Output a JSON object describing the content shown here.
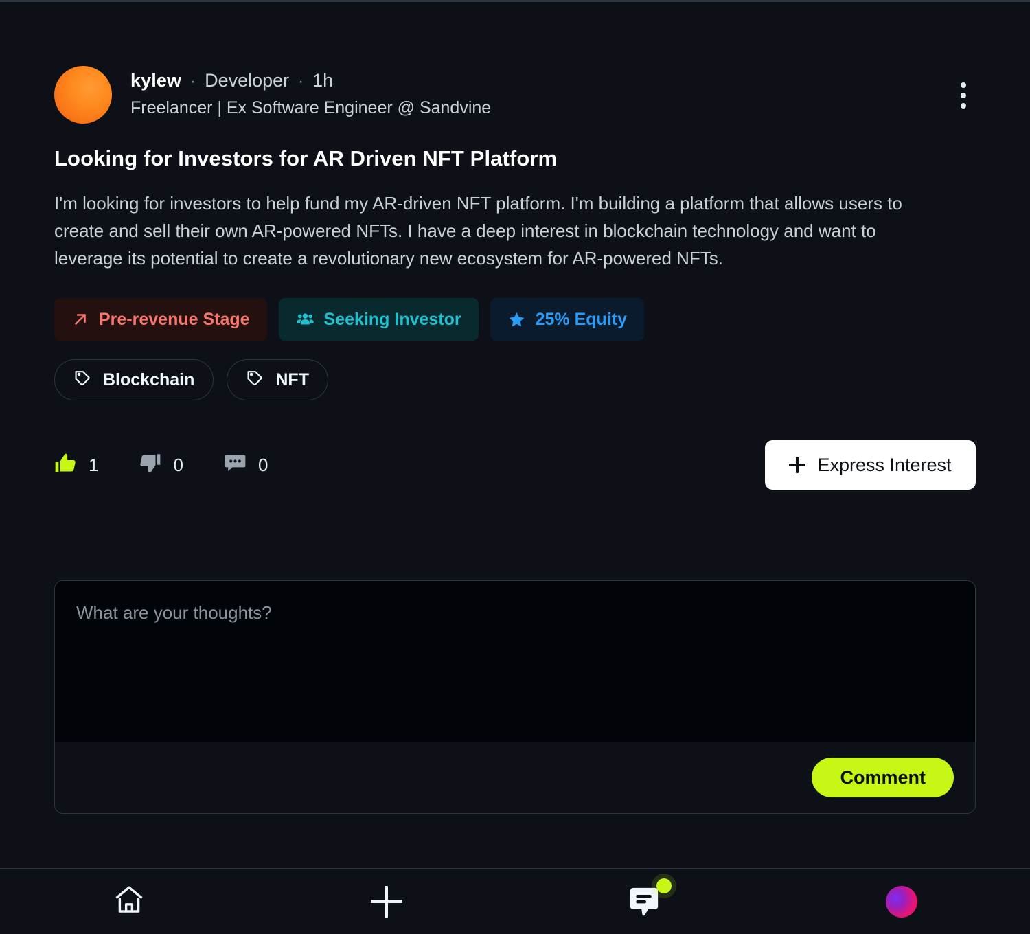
{
  "post": {
    "author": {
      "username": "kylew",
      "role": "Developer",
      "timestamp": "1h",
      "headline": "Freelancer | Ex Software Engineer @ Sandvine",
      "avatar_icon": "user-avatar",
      "avatar_color": "#f97316"
    },
    "separator": "·",
    "menu_icon": "kebab-menu-icon",
    "title": "Looking for Investors for AR Driven NFT Platform",
    "body": "I'm looking for investors to help fund my AR-driven NFT platform. I'm building a platform that allows users to create and sell their own AR-powered NFTs. I have a deep interest in blockchain technology and want to leverage its potential to create a revolutionary new ecosystem for AR-powered NFTs.",
    "badges": [
      {
        "label": "Pre-revenue Stage",
        "icon": "arrow-up-right-icon",
        "color": "#f8766d",
        "background": "#24100f"
      },
      {
        "label": "Seeking Investor",
        "icon": "users-group-icon",
        "color": "#1fc0d0",
        "background": "#082a2e"
      },
      {
        "label": "25% Equity",
        "icon": "star-icon",
        "color": "#2b9cf6",
        "background": "#0b1b2e"
      }
    ],
    "tags": [
      {
        "label": "Blockchain",
        "icon": "tag-icon"
      },
      {
        "label": "NFT",
        "icon": "tag-icon"
      }
    ],
    "reactions": {
      "like": {
        "count": "1",
        "icon": "thumbs-up-icon",
        "active": true,
        "color": "#c6f715"
      },
      "dislike": {
        "count": "0",
        "icon": "thumbs-down-icon",
        "active": false,
        "color": "#9aa4ae"
      },
      "comment": {
        "count": "0",
        "icon": "comment-icon",
        "active": false,
        "color": "#9aa4ae"
      }
    },
    "express_interest": {
      "label": "Express Interest",
      "icon": "plus-icon"
    }
  },
  "composer": {
    "placeholder": "What are your thoughts?",
    "value": "",
    "submit_label": "Comment",
    "submit_color": "#c6f715"
  },
  "bottom_nav": {
    "items": [
      {
        "name": "home",
        "icon": "home-icon"
      },
      {
        "name": "create",
        "icon": "plus-icon"
      },
      {
        "name": "messages",
        "icon": "chat-bubble-icon",
        "has_notification": true,
        "notification_color": "#c6f715"
      },
      {
        "name": "profile",
        "icon": "profile-avatar-icon"
      }
    ]
  }
}
